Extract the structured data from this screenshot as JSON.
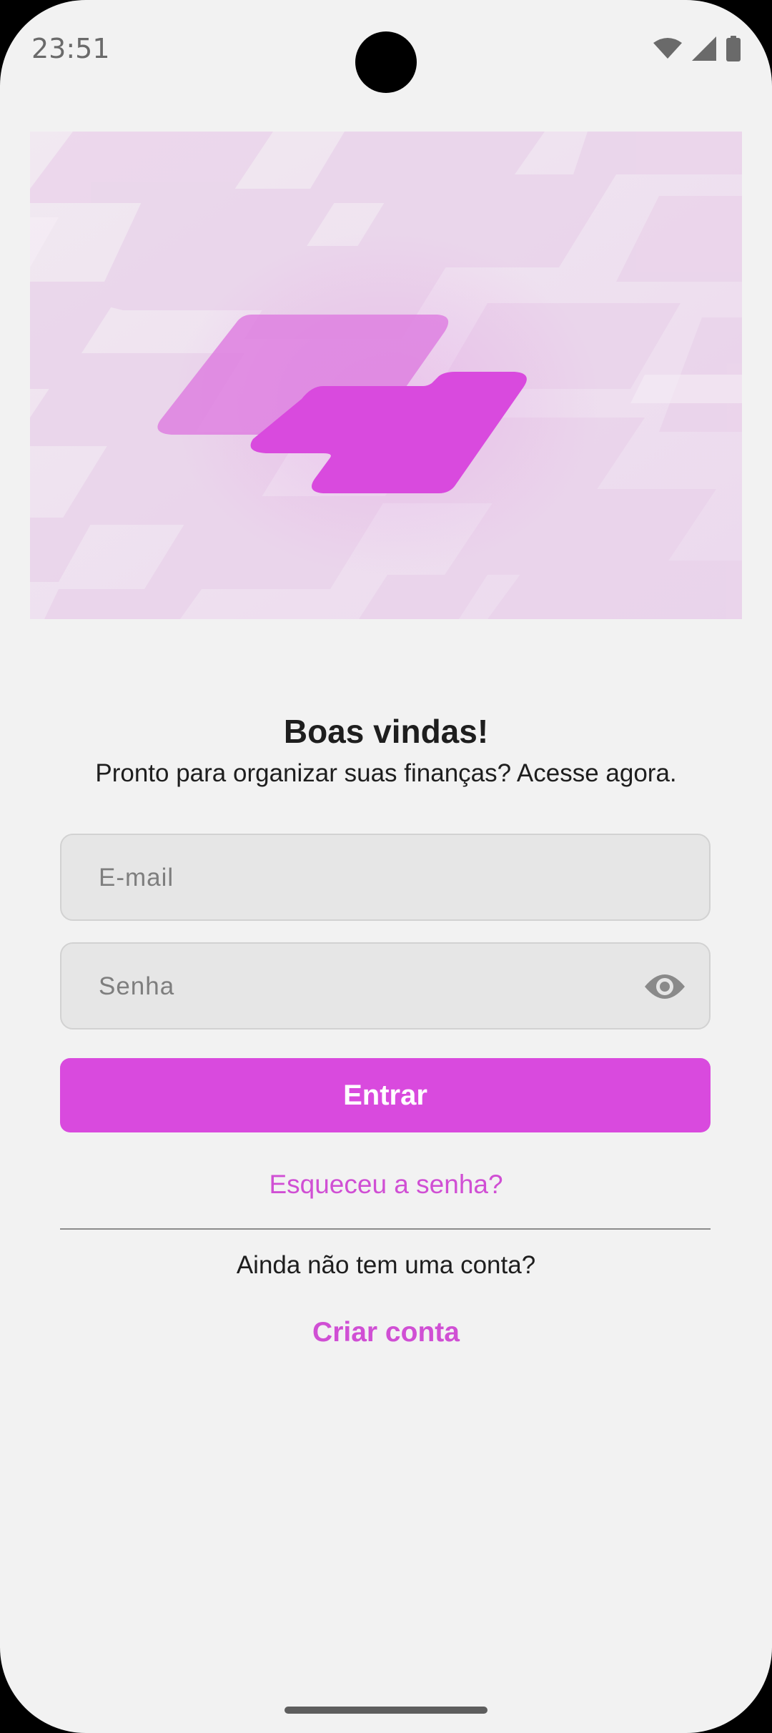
{
  "status_bar": {
    "time": "23:51",
    "icons": [
      "wifi-icon",
      "cell-signal-icon",
      "battery-icon"
    ]
  },
  "hero": {
    "logo_icon": "app-logo-icon"
  },
  "welcome": {
    "title": "Boas vindas!",
    "subtitle": "Pronto para organizar suas finanças? Acesse agora."
  },
  "form": {
    "email_placeholder": "E-mail",
    "email_value": "",
    "password_placeholder": "Senha",
    "password_value": "",
    "password_toggle_icon": "eye-icon",
    "login_label": "Entrar",
    "forgot_label": "Esqueceu a senha?"
  },
  "signup": {
    "prompt": "Ainda não tem uma conta?",
    "create_label": "Criar conta"
  },
  "colors": {
    "accent": "#d94ade",
    "link": "#d04fd4",
    "background": "#f2f2f2"
  }
}
